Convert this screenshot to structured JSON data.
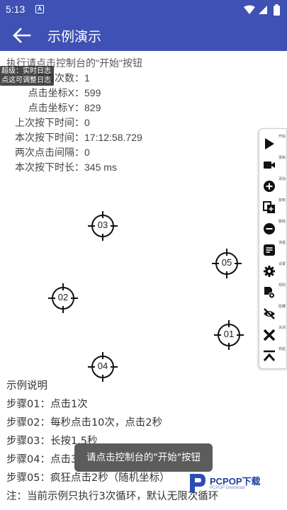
{
  "status_bar": {
    "time": "5:13",
    "notification_glyph": "A"
  },
  "app_bar": {
    "title": "示例演示"
  },
  "info": {
    "heading": "执行请点击控制台的\"开始\"按钮",
    "rows": [
      {
        "label": "点击次数：",
        "value": "1"
      },
      {
        "label": "点击坐标X：",
        "value": "599"
      },
      {
        "label": "点击坐标Y：",
        "value": "829"
      },
      {
        "label": "上次按下时间：",
        "value": "0"
      },
      {
        "label": "本次按下时间：",
        "value": "17:12:58.729"
      },
      {
        "label": "两次点击间隔：",
        "value": "0"
      },
      {
        "label": "本次按下时长：",
        "value": "345 ms"
      }
    ]
  },
  "log_badge": {
    "line1": "超级：实时日志",
    "line2": "点这可调整日志"
  },
  "targets": [
    "03",
    "05",
    "02",
    "01",
    "04"
  ],
  "toolbar": {
    "items": [
      {
        "icon": "play-icon",
        "label": "开始"
      },
      {
        "icon": "video-camera-icon",
        "label": "录制"
      },
      {
        "icon": "add-circle-icon",
        "label": "添加"
      },
      {
        "icon": "copy-icon",
        "label": "复制"
      },
      {
        "icon": "remove-circle-icon",
        "label": "删除"
      },
      {
        "icon": "list-icon",
        "label": "流程"
      },
      {
        "icon": "settings-icon",
        "label": "设置"
      },
      {
        "icon": "doc-settings-icon",
        "label": "规则"
      },
      {
        "icon": "eye-off-icon",
        "label": "隐藏"
      },
      {
        "icon": "close-icon",
        "label": "关闭"
      },
      {
        "icon": "collapse-icon",
        "label": "收起"
      }
    ]
  },
  "description": {
    "title": "示例说明",
    "steps": [
      "步骤01：点击1次",
      "步骤02：每秒点击10次，点击2秒",
      "步骤03：长按1.5秒",
      "步骤04：点击3",
      "步骤05：疯狂点击2秒（随机坐标）",
      "注：当前示例只执行3次循环，默认无限次循环"
    ]
  },
  "toast": {
    "text": "请点击控制台的\"开始\"按钮"
  },
  "watermark": {
    "brand": "PCPOP下载",
    "sub": "PCPOP Download"
  },
  "colors": {
    "primary": "#3f51b5",
    "toast_bg": "#5c5c5c"
  }
}
